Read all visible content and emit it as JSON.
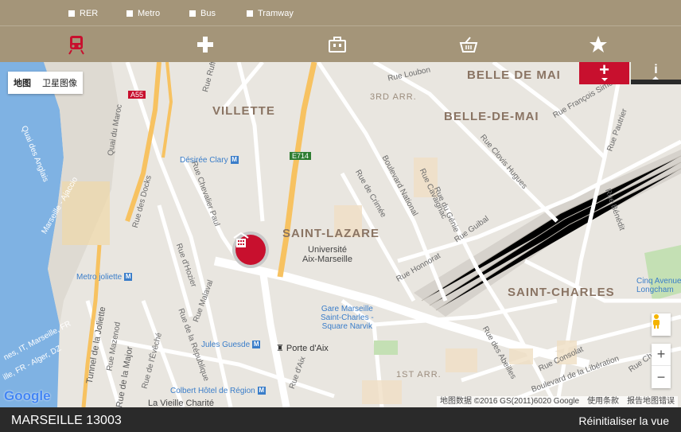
{
  "legend": [
    {
      "label": "RER"
    },
    {
      "label": "Metro"
    },
    {
      "label": "Bus"
    },
    {
      "label": "Tramway"
    }
  ],
  "categories": [
    {
      "icon": "train-icon",
      "active": true
    },
    {
      "icon": "cross-icon",
      "active": false
    },
    {
      "icon": "briefcase-icon",
      "active": false
    },
    {
      "icon": "basket-icon",
      "active": false
    },
    {
      "icon": "star-icon",
      "active": false
    }
  ],
  "map_type": {
    "map_label": "地图",
    "satellite_label": "卫星图像"
  },
  "districts": {
    "villette": "VILLETTE",
    "belle_de_mai_caps": "BELLE DE MAI",
    "belle_de_mai": "BELLE-DE-MAI",
    "saint_lazare": "SAINT-LAZARE",
    "saint_charles": "SAINT-CHARLES",
    "arr3": "3RD ARR.",
    "arr1": "1ST ARR."
  },
  "streets": {
    "rue_loubon": "Rue Loubon",
    "rue_ruffi": "Rue Ruffi",
    "quai_maroc": "Quai du Maroc",
    "a55": "A55",
    "e714": "E714",
    "quai_anglais": "Quai des Anglais",
    "ajaccio": "Marseille - Ajaccio",
    "rue_docks": "Rue des Docks",
    "rue_chevalier_paul": "Rue Chevalier Paul",
    "rue_hozier": "Rue d'Hozier",
    "rue_malaval": "Rue Malaval",
    "rue_republique": "Rue de la République",
    "rue_mazenod": "Rue Mazenod",
    "rue_eveche": "Rue de l'Évêché",
    "tunnel_joliette": "Tunnel de la Joliette",
    "rue_major": "Rue de la Major",
    "rue_aix": "Rue d'Aix",
    "bd_national": "Boulevard National",
    "rue_crimee": "Rue de Crimée",
    "rue_cavaignac": "Rue Cavaignac",
    "rue_gene": "Rue du Génie",
    "rue_guibal": "Rue Guibal",
    "rue_honnorat": "Rue Honnorat",
    "rue_clovis_hugues": "Rue Clovis Hugues",
    "rue_francois_simon": "Rue François Simon",
    "rue_pautrier": "Rue Pautrier",
    "rue_benedit": "Rue Bénédit",
    "rue_abeilles": "Rue des Abeilles",
    "rue_consolat": "Rue Consolat",
    "bd_liberation": "Boulevard de la Libération",
    "rue_chape": "Rue Chape",
    "quai": "quai",
    "marseille_fr": "nes, IT, Marseille, FR",
    "alger": "ille, FR - Alger, DZ"
  },
  "pois": {
    "desiree_clary": "Désirée Clary",
    "metro_joliette": "Metro joliette",
    "universite": "Université\nAix-Marseille",
    "gare": "Gare Marseille\nSaint-Charles -\nSquare Narvik",
    "jules_guesde": "Jules Guesde",
    "porte_aix": "Porte d'Aix",
    "colbert": "Colbert Hôtel de Région",
    "vieille_charite": "La Vieille Charité",
    "cinq_avenues": "Cinq Avenues\nLongcham"
  },
  "map_controls": {
    "zoom_in": "+",
    "zoom_out": "−"
  },
  "attribution": {
    "logo": "Google",
    "data": "地图数据 ©2016 GS(2011)6020 Google",
    "terms": "使用条款",
    "report": "报告地图错误"
  },
  "panel_controls": {
    "plus": "+",
    "info": "i"
  },
  "footer": {
    "location": "MARSEILLE 13003",
    "reset": "Réinitialiser la vue"
  },
  "colors": {
    "bar": "#a49579",
    "accent": "#c8102e",
    "footer": "#2a2a2a"
  }
}
